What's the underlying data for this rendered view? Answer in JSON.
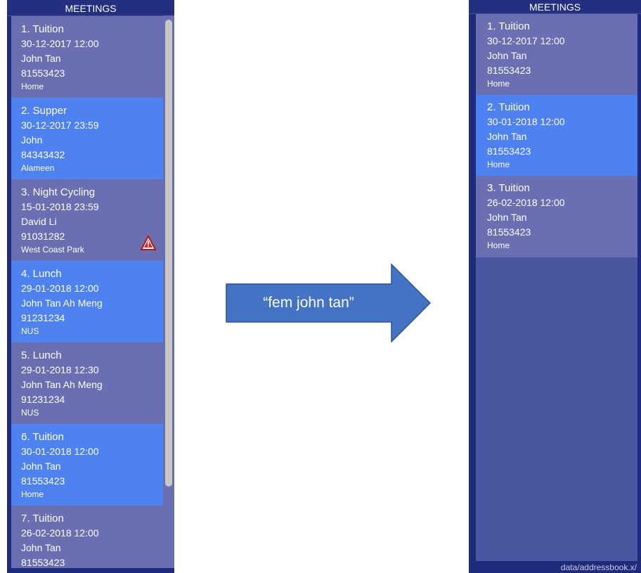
{
  "colors": {
    "panel_bg": "#1f2a7a",
    "card_odd": "#6a6fb3",
    "card_even": "#4d82f0",
    "list_empty": "#4b56a0",
    "arrow": "#4472c4"
  },
  "left_panel": {
    "header": "MEETINGS",
    "cards": [
      {
        "title": "1.  Tuition",
        "datetime": "30-12-2017 12:00",
        "name": "John Tan",
        "phone": "81553423",
        "location": "Home"
      },
      {
        "title": "2.  Supper",
        "datetime": "30-12-2017 23:59",
        "name": "John",
        "phone": "84343432",
        "location": "Alameen"
      },
      {
        "title": "3.  Night Cycling",
        "datetime": "15-01-2018 23:59",
        "name": "David Li",
        "phone": "91031282",
        "location": "West Coast Park",
        "icon": "warning-icon"
      },
      {
        "title": "4.  Lunch",
        "datetime": "29-01-2018 12:00",
        "name": "John Tan Ah Meng",
        "phone": "91231234",
        "location": "NUS"
      },
      {
        "title": "5.  Lunch",
        "datetime": "29-01-2018 12:30",
        "name": "John Tan Ah Meng",
        "phone": "91231234",
        "location": "NUS"
      },
      {
        "title": "6.  Tuition",
        "datetime": "30-01-2018 12:00",
        "name": "John Tan",
        "phone": "81553423",
        "location": "Home"
      },
      {
        "title": "7.  Tuition",
        "datetime": "26-02-2018 12:00",
        "name": "John Tan",
        "phone": "81553423",
        "location": ""
      }
    ]
  },
  "command": {
    "label": "“fem john tan”"
  },
  "right_panel": {
    "header": "MEETINGS",
    "cards": [
      {
        "title": "1.  Tuition",
        "datetime": "30-12-2017 12:00",
        "name": "John Tan",
        "phone": "81553423",
        "location": "Home"
      },
      {
        "title": "2.  Tuition",
        "datetime": "30-01-2018 12:00",
        "name": "John Tan",
        "phone": "81553423",
        "location": "Home"
      },
      {
        "title": "3.  Tuition",
        "datetime": "26-02-2018 12:00",
        "name": "John Tan",
        "phone": "81553423",
        "location": "Home"
      }
    ],
    "status": "data/addressbook.x/"
  }
}
